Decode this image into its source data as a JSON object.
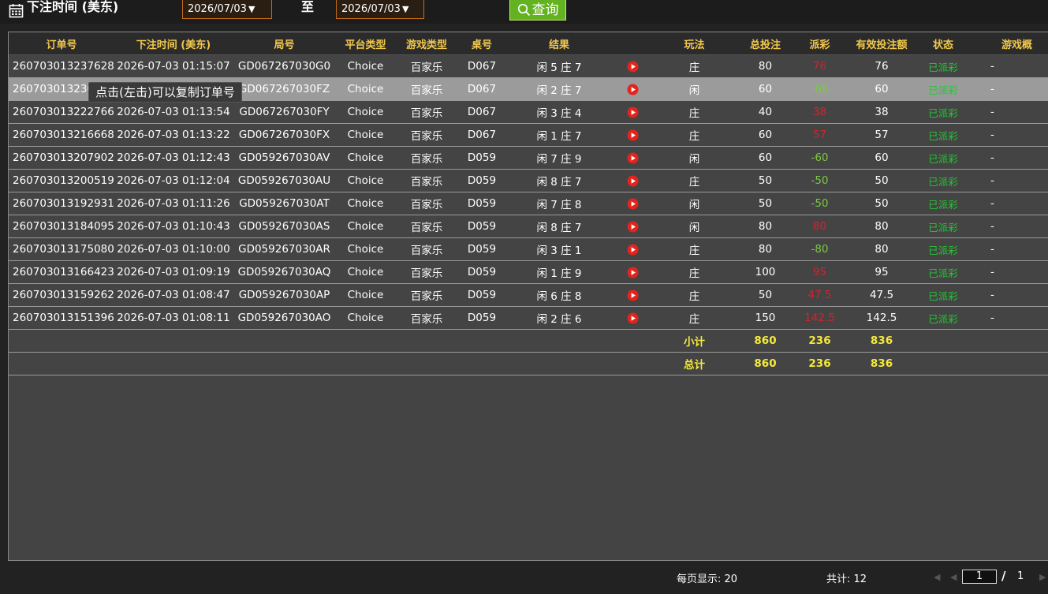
{
  "header": {
    "title": "下注时间 (美东)",
    "date_from": "2026/07/03",
    "to_label": "至",
    "date_to": "2026/07/03",
    "query_label": "查询"
  },
  "columns": [
    "订单号",
    "下注时间 (美东)",
    "局号",
    "平台类型",
    "游戏类型",
    "桌号",
    "结果",
    "",
    "玩法",
    "总投注",
    "派彩",
    "有效投注额",
    "状态",
    "游戏概"
  ],
  "rows": [
    {
      "order": "260703013237628",
      "time": "2026-07-03 01:15:07",
      "round": "GD067267030G0",
      "platform": "Choice",
      "game": "百家乐",
      "table": "D067",
      "result": "闲 5 庄 7",
      "play": "庄",
      "bet": "80",
      "payout": "76",
      "valid": "76",
      "status": "已派彩",
      "extra": "-",
      "win": true
    },
    {
      "order": "260703013230",
      "time": "",
      "round": "GD067267030FZ",
      "platform": "Choice",
      "game": "百家乐",
      "table": "D067",
      "result": "闲 2 庄 7",
      "play": "闲",
      "bet": "60",
      "payout": "-60",
      "valid": "60",
      "status": "已派彩",
      "extra": "-",
      "win": false
    },
    {
      "order": "260703013222766",
      "time": "2026-07-03 01:13:54",
      "round": "GD067267030FY",
      "platform": "Choice",
      "game": "百家乐",
      "table": "D067",
      "result": "闲 3 庄 4",
      "play": "庄",
      "bet": "40",
      "payout": "38",
      "valid": "38",
      "status": "已派彩",
      "extra": "-",
      "win": true
    },
    {
      "order": "260703013216668",
      "time": "2026-07-03 01:13:22",
      "round": "GD067267030FX",
      "platform": "Choice",
      "game": "百家乐",
      "table": "D067",
      "result": "闲 1 庄 7",
      "play": "庄",
      "bet": "60",
      "payout": "57",
      "valid": "57",
      "status": "已派彩",
      "extra": "-",
      "win": true
    },
    {
      "order": "260703013207902",
      "time": "2026-07-03 01:12:43",
      "round": "GD059267030AV",
      "platform": "Choice",
      "game": "百家乐",
      "table": "D059",
      "result": "闲 7 庄 9",
      "play": "闲",
      "bet": "60",
      "payout": "-60",
      "valid": "60",
      "status": "已派彩",
      "extra": "-",
      "win": false
    },
    {
      "order": "260703013200519",
      "time": "2026-07-03 01:12:04",
      "round": "GD059267030AU",
      "platform": "Choice",
      "game": "百家乐",
      "table": "D059",
      "result": "闲 8 庄 7",
      "play": "庄",
      "bet": "50",
      "payout": "-50",
      "valid": "50",
      "status": "已派彩",
      "extra": "-",
      "win": false
    },
    {
      "order": "260703013192931",
      "time": "2026-07-03 01:11:26",
      "round": "GD059267030AT",
      "platform": "Choice",
      "game": "百家乐",
      "table": "D059",
      "result": "闲 7 庄 8",
      "play": "闲",
      "bet": "50",
      "payout": "-50",
      "valid": "50",
      "status": "已派彩",
      "extra": "-",
      "win": false
    },
    {
      "order": "260703013184095",
      "time": "2026-07-03 01:10:43",
      "round": "GD059267030AS",
      "platform": "Choice",
      "game": "百家乐",
      "table": "D059",
      "result": "闲 8 庄 7",
      "play": "闲",
      "bet": "80",
      "payout": "80",
      "valid": "80",
      "status": "已派彩",
      "extra": "-",
      "win": true
    },
    {
      "order": "260703013175080",
      "time": "2026-07-03 01:10:00",
      "round": "GD059267030AR",
      "platform": "Choice",
      "game": "百家乐",
      "table": "D059",
      "result": "闲 3 庄 1",
      "play": "庄",
      "bet": "80",
      "payout": "-80",
      "valid": "80",
      "status": "已派彩",
      "extra": "-",
      "win": false
    },
    {
      "order": "260703013166423",
      "time": "2026-07-03 01:09:19",
      "round": "GD059267030AQ",
      "platform": "Choice",
      "game": "百家乐",
      "table": "D059",
      "result": "闲 1 庄 9",
      "play": "庄",
      "bet": "100",
      "payout": "95",
      "valid": "95",
      "status": "已派彩",
      "extra": "-",
      "win": true
    },
    {
      "order": "260703013159262",
      "time": "2026-07-03 01:08:47",
      "round": "GD059267030AP",
      "platform": "Choice",
      "game": "百家乐",
      "table": "D059",
      "result": "闲 6 庄 8",
      "play": "庄",
      "bet": "50",
      "payout": "47.5",
      "valid": "47.5",
      "status": "已派彩",
      "extra": "-",
      "win": true
    },
    {
      "order": "260703013151396",
      "time": "2026-07-03 01:08:11",
      "round": "GD059267030AO",
      "platform": "Choice",
      "game": "百家乐",
      "table": "D059",
      "result": "闲 2 庄 6",
      "play": "庄",
      "bet": "150",
      "payout": "142.5",
      "valid": "142.5",
      "status": "已派彩",
      "extra": "-",
      "win": true
    }
  ],
  "subtotal": {
    "label": "小计",
    "bet": "860",
    "payout": "236",
    "valid": "836"
  },
  "total": {
    "label": "总计",
    "bet": "860",
    "payout": "236",
    "valid": "836"
  },
  "tooltip": "点击(左击)可以复制订单号",
  "footer": {
    "per_page": "每页显示: 20",
    "total_count": "共计: 12",
    "current_page": "1",
    "slash": "/",
    "total_pages": "1"
  },
  "colors": {
    "win": "#d0252f",
    "lose": "#7ac943",
    "paid": "#22c832",
    "header_text": "#f2c84b",
    "totals": "#f4ea3a",
    "query_btn": "#63b21f"
  },
  "icons": {
    "calendar": "calendar-icon",
    "play": "play-video-icon",
    "search": "search-icon"
  }
}
